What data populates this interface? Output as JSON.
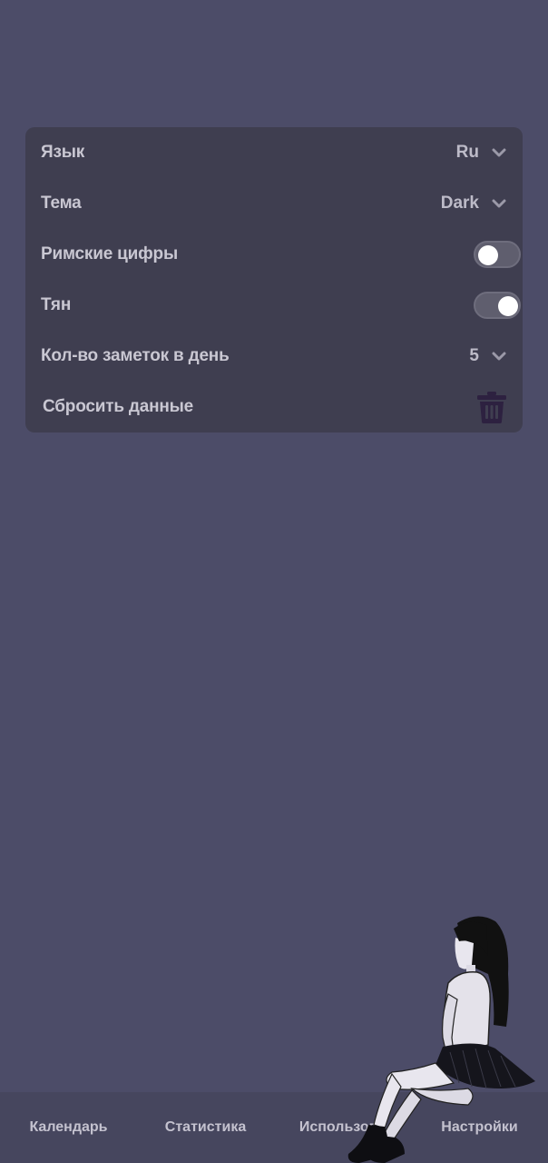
{
  "settings": {
    "language": {
      "label": "Язык",
      "value": "Ru",
      "icon": "chevron-down-icon"
    },
    "theme": {
      "label": "Тема",
      "value": "Dark",
      "icon": "chevron-down-icon"
    },
    "roman_numerals": {
      "label": "Римские цифры",
      "toggle": "off"
    },
    "tyan": {
      "label": "Тян",
      "toggle": "on"
    },
    "notes_per_day": {
      "label": "Кол-во заметок в день",
      "value": "5",
      "icon": "chevron-down-icon"
    },
    "reset": {
      "label": "Сбросить данные",
      "icon": "trash-icon"
    }
  },
  "nav": {
    "calendar": "Календарь",
    "statistics": "Статистика",
    "usage": "Использова",
    "settings": "Настройки"
  },
  "colors": {
    "background": "#4c4c68",
    "card": "#3f3e50",
    "trash": "#2d2140"
  }
}
